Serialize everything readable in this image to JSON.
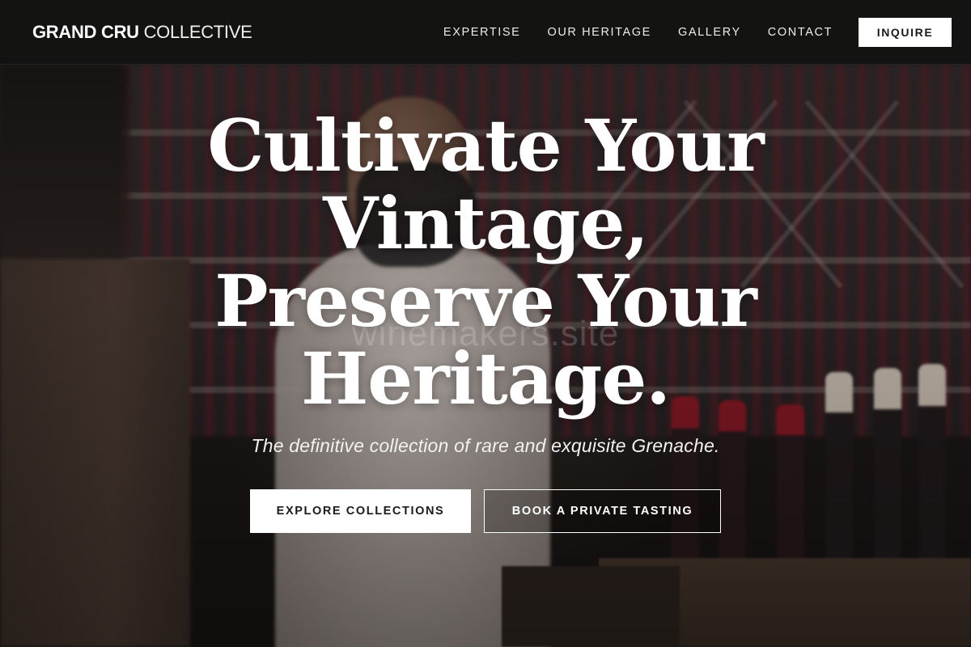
{
  "brand": {
    "name_bold": "GRAND CRU",
    "name_light": "COLLECTIVE"
  },
  "nav": {
    "links": [
      {
        "label": "EXPERTISE"
      },
      {
        "label": "OUR HERITAGE"
      },
      {
        "label": "GALLERY"
      },
      {
        "label": "CONTACT"
      }
    ],
    "cta_label": "INQUIRE"
  },
  "hero": {
    "title_lines": [
      "Cultivate Your",
      "Vintage,",
      "Preserve Your",
      "Heritage."
    ],
    "watermark": "winemakers.site",
    "subtitle": "The definitive collection of rare and exquisite Grenache.",
    "primary_cta": "EXPLORE COLLECTIONS",
    "secondary_cta": "BOOK A PRIVATE TASTING"
  },
  "colors": {
    "nav_background": "#121212",
    "text_primary": "#ffffff",
    "button_fill": "#ffffff",
    "button_text": "#1a1a1a"
  }
}
